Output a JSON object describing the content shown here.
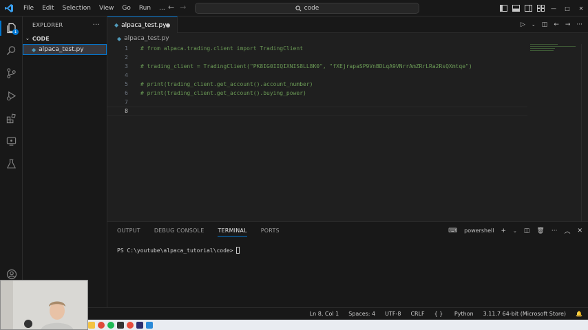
{
  "window": {
    "command_center": "code"
  },
  "menu": [
    "File",
    "Edit",
    "Selection",
    "View",
    "Go",
    "Run",
    "..."
  ],
  "activity": {
    "badge": "1"
  },
  "sidebar": {
    "title": "EXPLORER",
    "folder": "CODE",
    "file": "alpaca_test.py"
  },
  "tab": {
    "label": "alpaca_test.py"
  },
  "breadcrumb": "alpaca_test.py",
  "editor": {
    "lines": [
      {
        "num": "1",
        "text": "# from alpaca.trading.client import TradingClient"
      },
      {
        "num": "2",
        "text": ""
      },
      {
        "num": "3",
        "text": "# trading_client = TradingClient(\"PK8IG0IIQIXNIS8LL8K0\", \"fXEjrapaSP9VnBDLqA9VNrrAmZRrLRa2RsQXmtqe\")"
      },
      {
        "num": "4",
        "text": ""
      },
      {
        "num": "5",
        "text": "# print(trading_client.get_account().account_number)"
      },
      {
        "num": "6",
        "text": "# print(trading_client.get_account().buying_power)"
      },
      {
        "num": "7",
        "text": ""
      },
      {
        "num": "8",
        "text": ""
      }
    ]
  },
  "panel": {
    "tabs": [
      "OUTPUT",
      "DEBUG CONSOLE",
      "TERMINAL",
      "PORTS"
    ],
    "shell": "powershell",
    "prompt": "PS C:\\youtube\\alpaca_tutorial\\code>"
  },
  "status": {
    "position": "Ln 8, Col 1",
    "spaces": "Spaces: 4",
    "encoding": "UTF-8",
    "eol": "CRLF",
    "language": "Python",
    "interpreter": "3.11.7 64-bit (Microsoft Store)"
  }
}
